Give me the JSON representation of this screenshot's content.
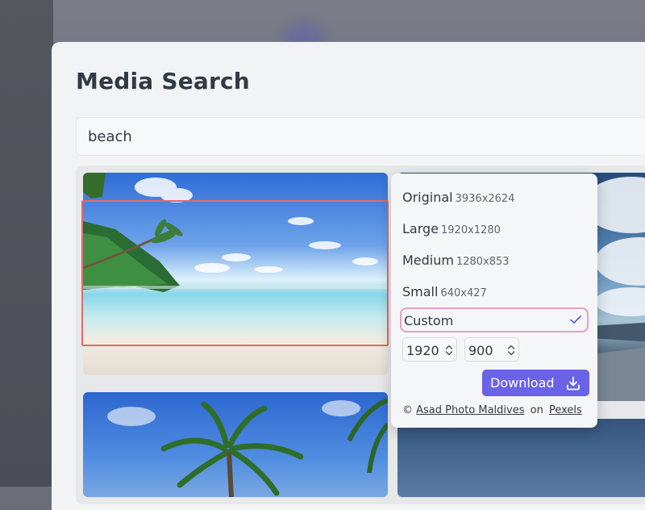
{
  "app": {
    "title": "Media Search"
  },
  "search": {
    "value": "beach"
  },
  "sizes": [
    {
      "label": "Original",
      "dims": "3936x2624"
    },
    {
      "label": "Large",
      "dims": "1920x1280"
    },
    {
      "label": "Medium",
      "dims": "1280x853"
    },
    {
      "label": "Small",
      "dims": "640x427"
    }
  ],
  "custom": {
    "label": "Custom",
    "width": "1920",
    "height": "900"
  },
  "download": {
    "label": "Download"
  },
  "credit": {
    "prefix": "©",
    "author": "Asad Photo Maldives",
    "on": "on",
    "source": "Pexels"
  },
  "colors": {
    "accent": "#6a63e6",
    "selected_border": "#ea9cc8",
    "highlight_border": "#e26a6a"
  },
  "icons": {
    "check": "check-icon",
    "download": "download-icon",
    "spinner": "chevron-up-down-icon"
  }
}
